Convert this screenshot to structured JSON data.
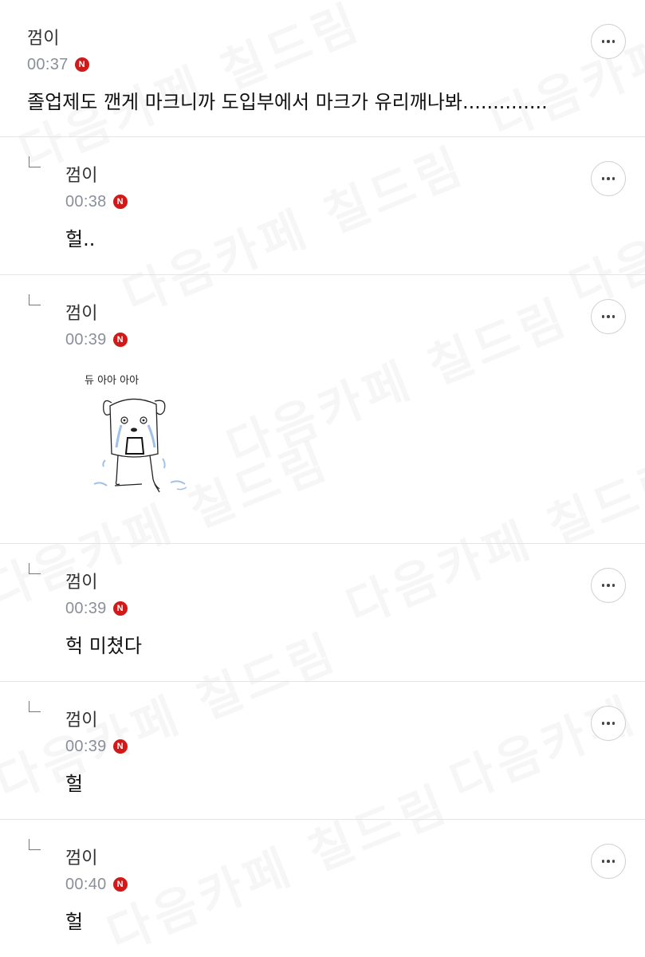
{
  "watermark_text": "다음카페 칠드림",
  "comments": [
    {
      "author": "껌이",
      "time": "00:37",
      "badge": "N",
      "text": "졸업제도 깬게 마크니까 도입부에서 마크가 유리깨나봐.............."
    },
    {
      "author": "껌이",
      "time": "00:38",
      "badge": "N",
      "text": "헐.."
    },
    {
      "author": "껌이",
      "time": "00:39",
      "badge": "N",
      "image_caption": "듀 아아 아아",
      "image_icon": "crying-dog-drawing"
    },
    {
      "author": "껌이",
      "time": "00:39",
      "badge": "N",
      "text": "헉 미쳤다"
    },
    {
      "author": "껌이",
      "time": "00:39",
      "badge": "N",
      "text": "헐"
    },
    {
      "author": "껌이",
      "time": "00:40",
      "badge": "N",
      "text": "헐"
    }
  ],
  "colors": {
    "badge": "#d01a1a",
    "time": "#8a8f9c",
    "divider": "#e4e4e4"
  }
}
